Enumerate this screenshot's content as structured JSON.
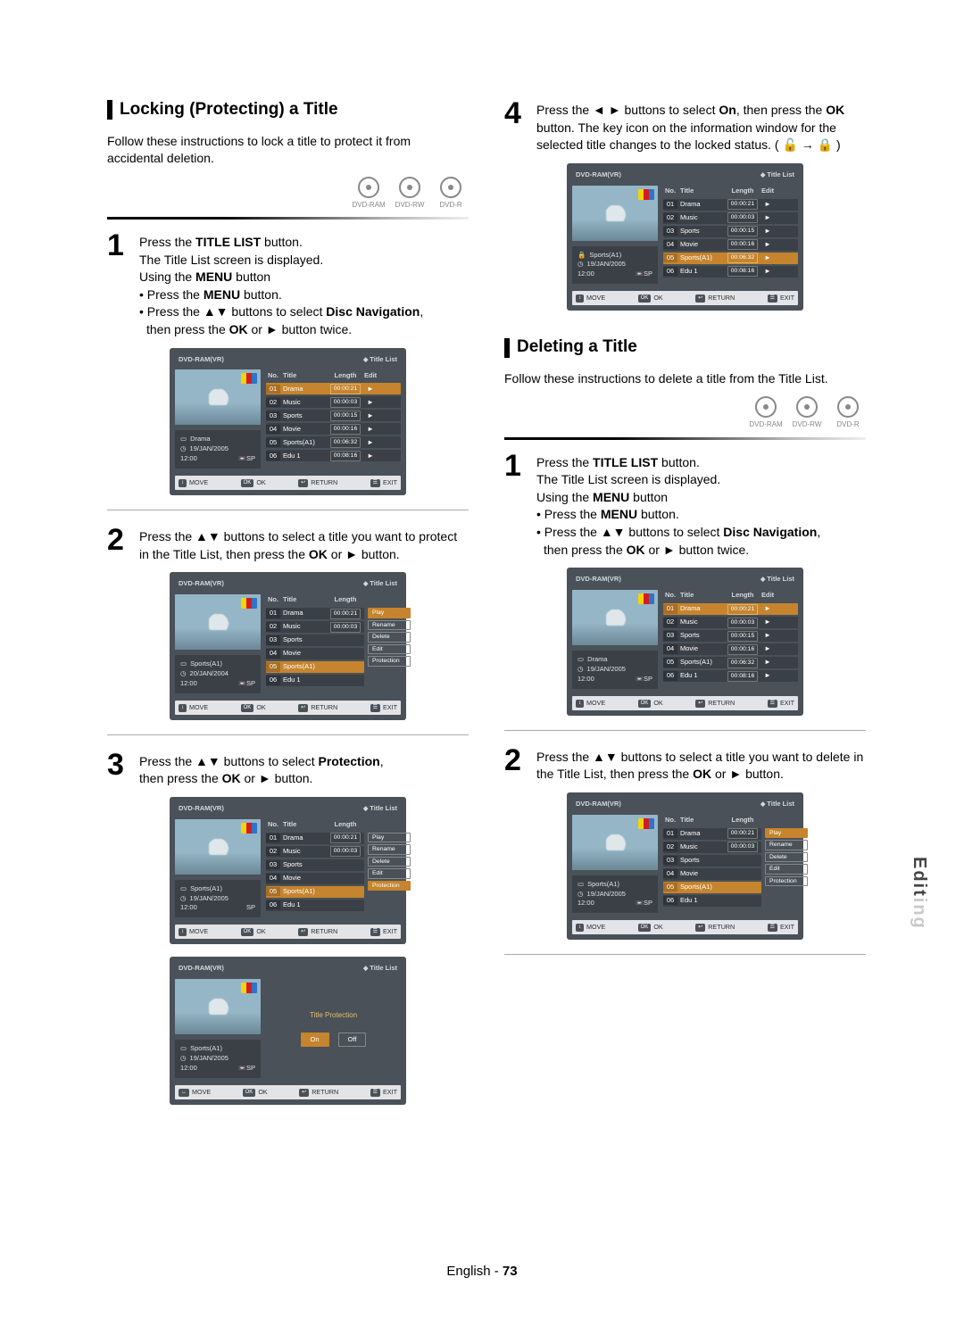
{
  "sideTab": "Editing",
  "footer": {
    "lang": "English",
    "page": "73"
  },
  "discLabels": [
    "DVD-RAM",
    "DVD-RW",
    "DVD-R"
  ],
  "osdCommon": {
    "device": "DVD-RAM(VR)",
    "listLabel": "Title List",
    "headers": {
      "no": "No.",
      "title": "Title",
      "length": "Length",
      "edit": "Edit"
    },
    "footer": {
      "move": "MOVE",
      "ok": "OK",
      "return": "RETURN",
      "exit": "EXIT"
    },
    "arrow": "►"
  },
  "titleRows": [
    {
      "no": "01",
      "title": "Drama",
      "length": "00:00:21"
    },
    {
      "no": "02",
      "title": "Music",
      "length": "00:00:03"
    },
    {
      "no": "03",
      "title": "Sports",
      "length": "00:00:15"
    },
    {
      "no": "04",
      "title": "Movie",
      "length": "00:00:16"
    },
    {
      "no": "05",
      "title": "Sports(A1)",
      "length": "00:06:32"
    },
    {
      "no": "06",
      "title": "Edu 1",
      "length": "00:08:16"
    }
  ],
  "editMenu": [
    "Play",
    "Rename",
    "Delete",
    "Edit",
    "Protection"
  ],
  "info": {
    "drama": {
      "title": "Drama",
      "date": "19/JAN/2005",
      "time": "12:00",
      "mode": "SP"
    },
    "sports04": {
      "title": "Sports(A1)",
      "date": "20/JAN/2004",
      "time": "12:00",
      "mode": "SP"
    },
    "sports05": {
      "title": "Sports(A1)",
      "date": "19/JAN/2005",
      "time": "12:00",
      "mode": "SP"
    }
  },
  "protection": {
    "title": "Title Protection",
    "on": "On",
    "off": "Off"
  },
  "left": {
    "heading": "Locking (Protecting) a Title",
    "intro": "Follow these instructions to lock a title to protect it from accidental deletion.",
    "step1": {
      "l1a": "Press the ",
      "l1b": "TITLE LIST",
      "l1c": " button.",
      "l2": "The Title List screen is displayed.",
      "l3a": "Using the ",
      "l3b": "MENU",
      "l3c": " button",
      "b1a": "Press the ",
      "b1b": "MENU",
      "b1c": " button.",
      "b2a": "Press the ▲▼ buttons to select ",
      "b2b": "Disc Navigation",
      "b2c": ",",
      "b2d": "then press the ",
      "b2e": "OK",
      "b2f": " or ► button twice."
    },
    "step2": {
      "a": "Press the ▲▼ buttons to select a title you want to protect in the Title List, then press the ",
      "b": "OK",
      "c": " or ► button."
    },
    "step3": {
      "a": "Press the ▲▼ buttons to select ",
      "b": "Protection",
      "c": ",",
      "d": "then press the ",
      "e": "OK",
      "f": " or ► button."
    }
  },
  "right": {
    "step4": {
      "a": "Press the ◄ ► buttons to select ",
      "b": "On",
      "c": ", then press the ",
      "d": "OK",
      "e": " button. The key icon on the information window for the selected title changes to the locked status. ( 🔓 → 🔒 )"
    },
    "heading": "Deleting a Title",
    "intro": "Follow these instructions to delete a title from the Title List.",
    "step1": {
      "l1a": "Press the ",
      "l1b": "TITLE LIST",
      "l1c": " button.",
      "l2": "The Title List screen is displayed.",
      "l3a": "Using the ",
      "l3b": "MENU",
      "l3c": " button",
      "b1a": "Press the ",
      "b1b": "MENU",
      "b1c": " button.",
      "b2a": "Press the ▲▼ buttons to select ",
      "b2b": "Disc Navigation",
      "b2c": ",",
      "b2d": "then press the ",
      "b2e": "OK",
      "b2f": " or ► button twice."
    },
    "step2": {
      "a": "Press the ▲▼ buttons to select a title you want to delete in the Title List, then press the ",
      "b": "OK",
      "c": " or ► button."
    }
  }
}
